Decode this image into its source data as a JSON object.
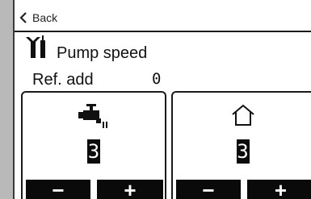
{
  "nav": {
    "back_label": "Back"
  },
  "header": {
    "title": "Pump speed",
    "icon": "tools-icon"
  },
  "ref": {
    "label": "Ref. add",
    "value": "0"
  },
  "panels": [
    {
      "icon": "hot-water-tap-icon",
      "value": "3",
      "minus_label": "−",
      "plus_label": "+"
    },
    {
      "icon": "house-icon",
      "value": "3",
      "minus_label": "−",
      "plus_label": "+"
    }
  ]
}
